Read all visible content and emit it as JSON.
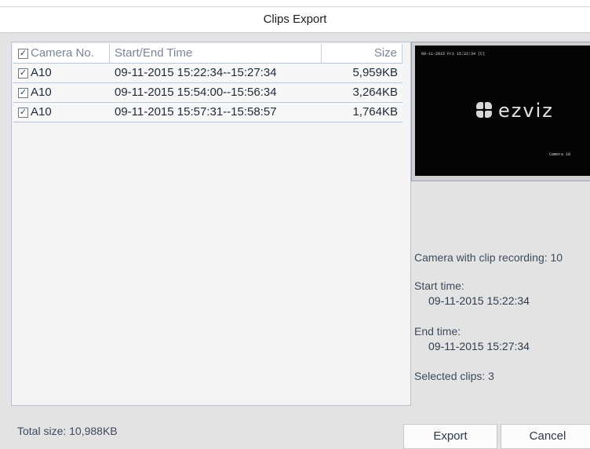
{
  "dialog": {
    "title": "Clips Export"
  },
  "table": {
    "header": {
      "camera_no": "Camera No.",
      "start_end_time": "Start/End Time",
      "size": "Size",
      "checkbox": "✓"
    },
    "rows": [
      {
        "checked": "✓",
        "camera": "A10",
        "time": "09-11-2015 15:22:34--15:27:34",
        "size": "5,959KB"
      },
      {
        "checked": "✓",
        "camera": "A10",
        "time": "09-11-2015 15:54:00--15:56:34",
        "size": "3,264KB"
      },
      {
        "checked": "✓",
        "camera": "A10",
        "time": "09-11-2015 15:57:31--15:58:57",
        "size": "1,764KB"
      }
    ]
  },
  "preview": {
    "osd_timestamp": "09-11-2015 Fri 15:22:34 (C)",
    "osd_camera": "Camera 10",
    "logo_text": "ezviz"
  },
  "info": {
    "camera_label": "Camera with clip recording: 10",
    "start_label": "Start time:",
    "start_value": "09-11-2015 15:22:34",
    "end_label": "End time:",
    "end_value": "09-11-2015 15:27:34",
    "selected_label": "Selected clips: 3"
  },
  "footer": {
    "total_size": "Total size: 10,988KB",
    "export_label": "Export",
    "cancel_label": "Cancel"
  },
  "colors": {
    "panel_bg": "#e3e3e3",
    "list_bg": "#f4f4f4",
    "grid_line": "#b6c4d4",
    "preview_bg": "#050505"
  }
}
